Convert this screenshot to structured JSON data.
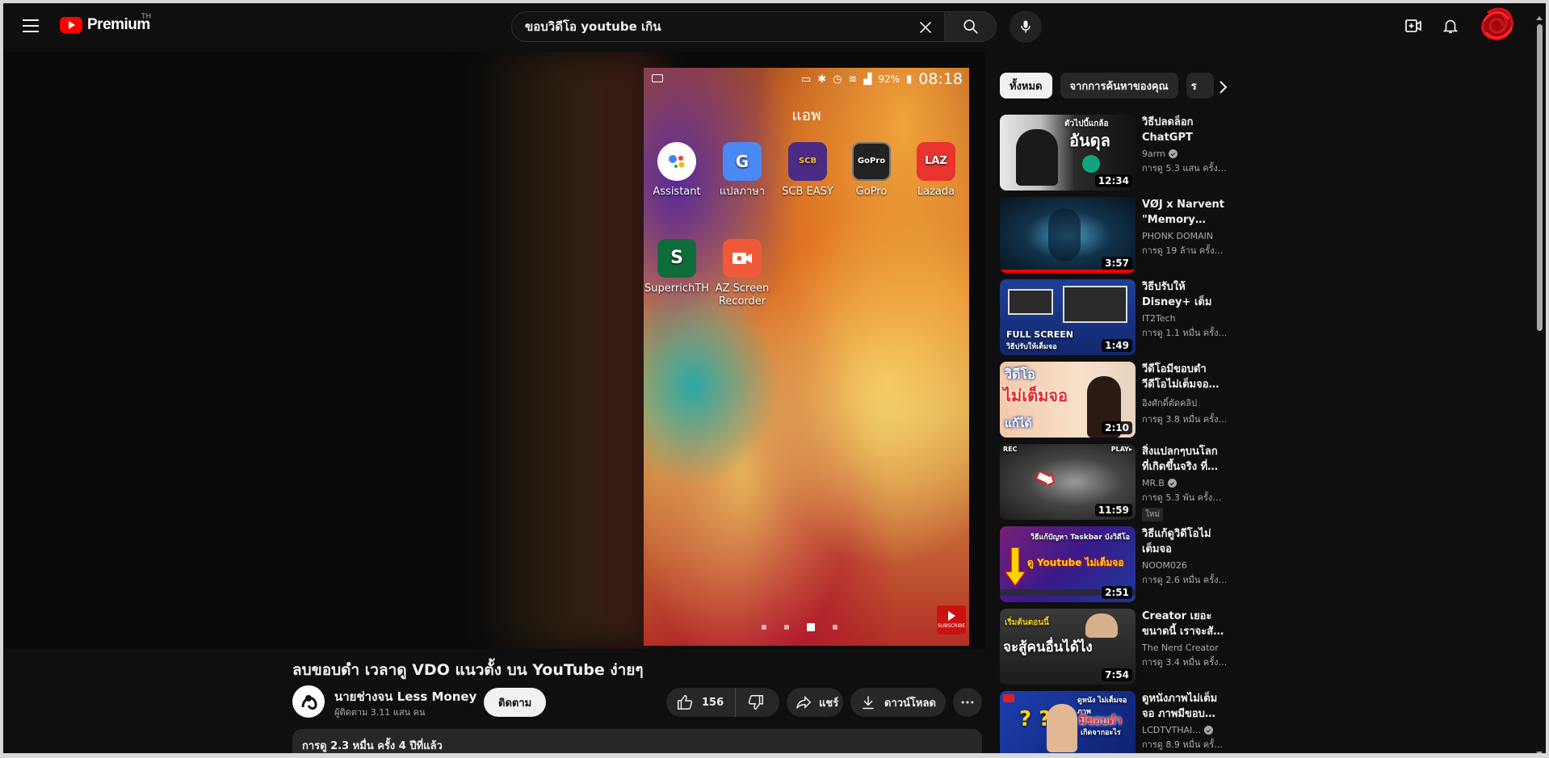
{
  "header": {
    "logo_text": "Premium",
    "country": "TH",
    "search_value": "ขอบวิดีโอ youtube เกิน"
  },
  "player": {
    "status_battery": "92%",
    "status_time": "08:18",
    "apps_title": "แอพ",
    "apps": [
      {
        "label": "Assistant"
      },
      {
        "label": "แปลภาษา"
      },
      {
        "label": "SCB EASY"
      },
      {
        "label": "GoPro"
      },
      {
        "label": "Lazada"
      },
      {
        "label": "SuperrichTH"
      },
      {
        "label": "AZ Screen Recorder"
      }
    ],
    "subscribe_badge": "SUBSCRIBE"
  },
  "video": {
    "title": "ลบขอบดำ เวลาดู VDO แนวตั้ง บน YouTube ง่ายๆ",
    "channel_name": "นายช่างจน Less Money",
    "channel_subs": "ผู้ติดตาม 3.11 แสน คน",
    "subscribe_label": "ติดตาม",
    "likes": "156",
    "share_label": "แชร์",
    "download_label": "ดาวน์โหลด",
    "description_stats": "การดู 2.3 หมื่น ครั้ง  4 ปีที่แล้ว"
  },
  "chips": [
    {
      "label": "ทั้งหมด",
      "active": true
    },
    {
      "label": "จากการค้นหาของคุณ",
      "active": false
    },
    {
      "label": "ร",
      "active": false
    }
  ],
  "recommendations": [
    {
      "title": "วิธีปลดล็อก ChatGPT",
      "channel": "9arm",
      "verified": true,
      "views": "การดู 5.3 แสน ครั้ง…",
      "duration": "12:34",
      "thumb_text": "อันดุล",
      "thumb_subtext": "ตัวไปบี้แกล้อ"
    },
    {
      "title": "VØJ x Narvent \"Memory…",
      "channel": "PHONK DOMAIN",
      "verified": false,
      "views": "การดู 19 ล้าน ครั้ง…",
      "duration": "3:57",
      "watched": 1.0
    },
    {
      "title": "วิธีปรับให้ Disney+ เต็มจ…",
      "channel": "IT2Tech",
      "verified": false,
      "views": "การดู 1.1 หมื่น ครั้ง…",
      "duration": "1:49",
      "thumb_text": "FULL SCREEN",
      "thumb_subtext": "วิธีปรับให้เต็มจอ"
    },
    {
      "title": "วีดีโอมีขอบดำ วีดีโอไม่เต็มจอ…",
      "channel": "อิงศักดิ์ตัดคลิป",
      "verified": false,
      "views": "การดู 3.8 หมื่น ครั้ง…",
      "duration": "2:10",
      "thumb_text": "ไม่เต็มจอ",
      "thumb_subtext": "วิดีโอ",
      "thumb_subtext2": "แก้ได้"
    },
    {
      "title": "สิ่งแปลกๆบนโลก ที่เกิดขึ้นจริง ที่…",
      "channel": "MR.B",
      "verified": true,
      "views": "การดู 5.3 พัน ครั้ง…",
      "duration": "11:59",
      "badge": "ใหม่",
      "thumb_rec": "REC",
      "thumb_play": "PLAY▸"
    },
    {
      "title": "วิธีแก้ดูวิดีโอไม่ เต็มจอ Taskba…",
      "channel": "NOOM026",
      "verified": false,
      "views": "การดู 2.6 หมื่น ครั้ง…",
      "duration": "2:51",
      "thumb_text": "ดู Youtube ไม่เต็มจอ",
      "thumb_subtext": "วิธีแก้ปัญหา Taskbar บังวิดีโอ"
    },
    {
      "title": "Creator เยอะ ขนาดนี้ เราจะสั…",
      "channel": "The Nerd Creator",
      "verified": false,
      "views": "การดู 3.4 หมื่น ครั้ง…",
      "duration": "7:54",
      "thumb_text": "จะสู้คนอื่นได้ไง",
      "thumb_subtext": "เริ่มต้นตอนนี้"
    },
    {
      "title": "ดูหนังภาพไม่เต็ม จอ ภาพมีขอบ…",
      "channel": "LCDTVTHAI…",
      "verified": true,
      "views": "การดู 8.9 หมื่น ครั้…",
      "thumb_text": "มีขอบดำ",
      "thumb_subtext": "ดูหนัง ไม่เต็มจอ ภาพ",
      "thumb_subtext2": "เกิดจากอะไร"
    }
  ]
}
